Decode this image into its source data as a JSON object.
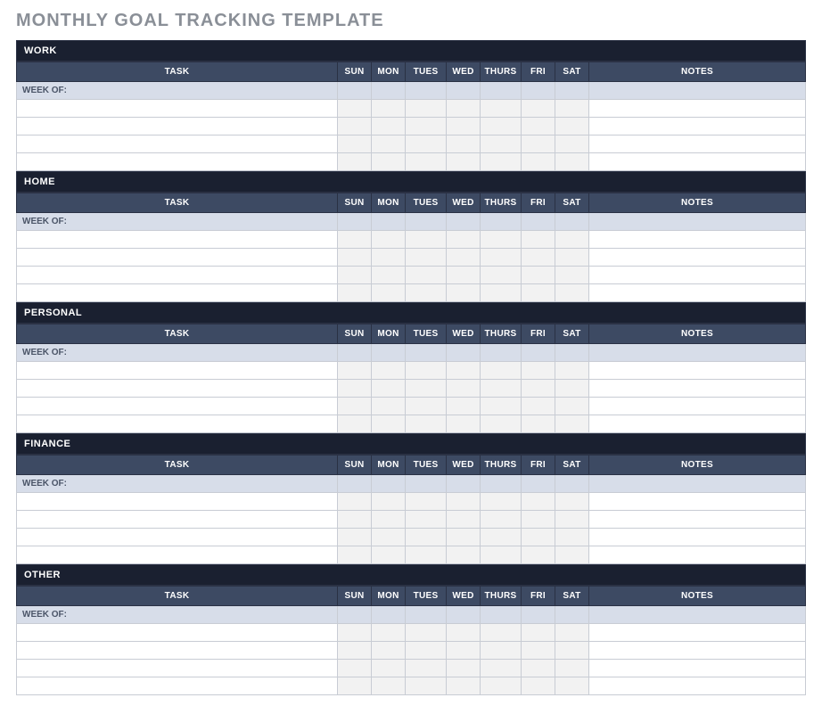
{
  "title": "MONTHLY GOAL TRACKING TEMPLATE",
  "columns": {
    "task": "TASK",
    "days": [
      "SUN",
      "MON",
      "TUES",
      "WED",
      "THURS",
      "FRI",
      "SAT"
    ],
    "notes": "NOTES"
  },
  "week_of_label": "WEEK OF:",
  "sections": [
    {
      "name": "WORK",
      "rows": [
        "",
        "",
        "",
        ""
      ]
    },
    {
      "name": "HOME",
      "rows": [
        "",
        "",
        "",
        ""
      ]
    },
    {
      "name": "PERSONAL",
      "rows": [
        "",
        "",
        "",
        ""
      ]
    },
    {
      "name": "FINANCE",
      "rows": [
        "",
        "",
        "",
        ""
      ]
    },
    {
      "name": "OTHER",
      "rows": [
        "",
        "",
        "",
        ""
      ]
    }
  ]
}
